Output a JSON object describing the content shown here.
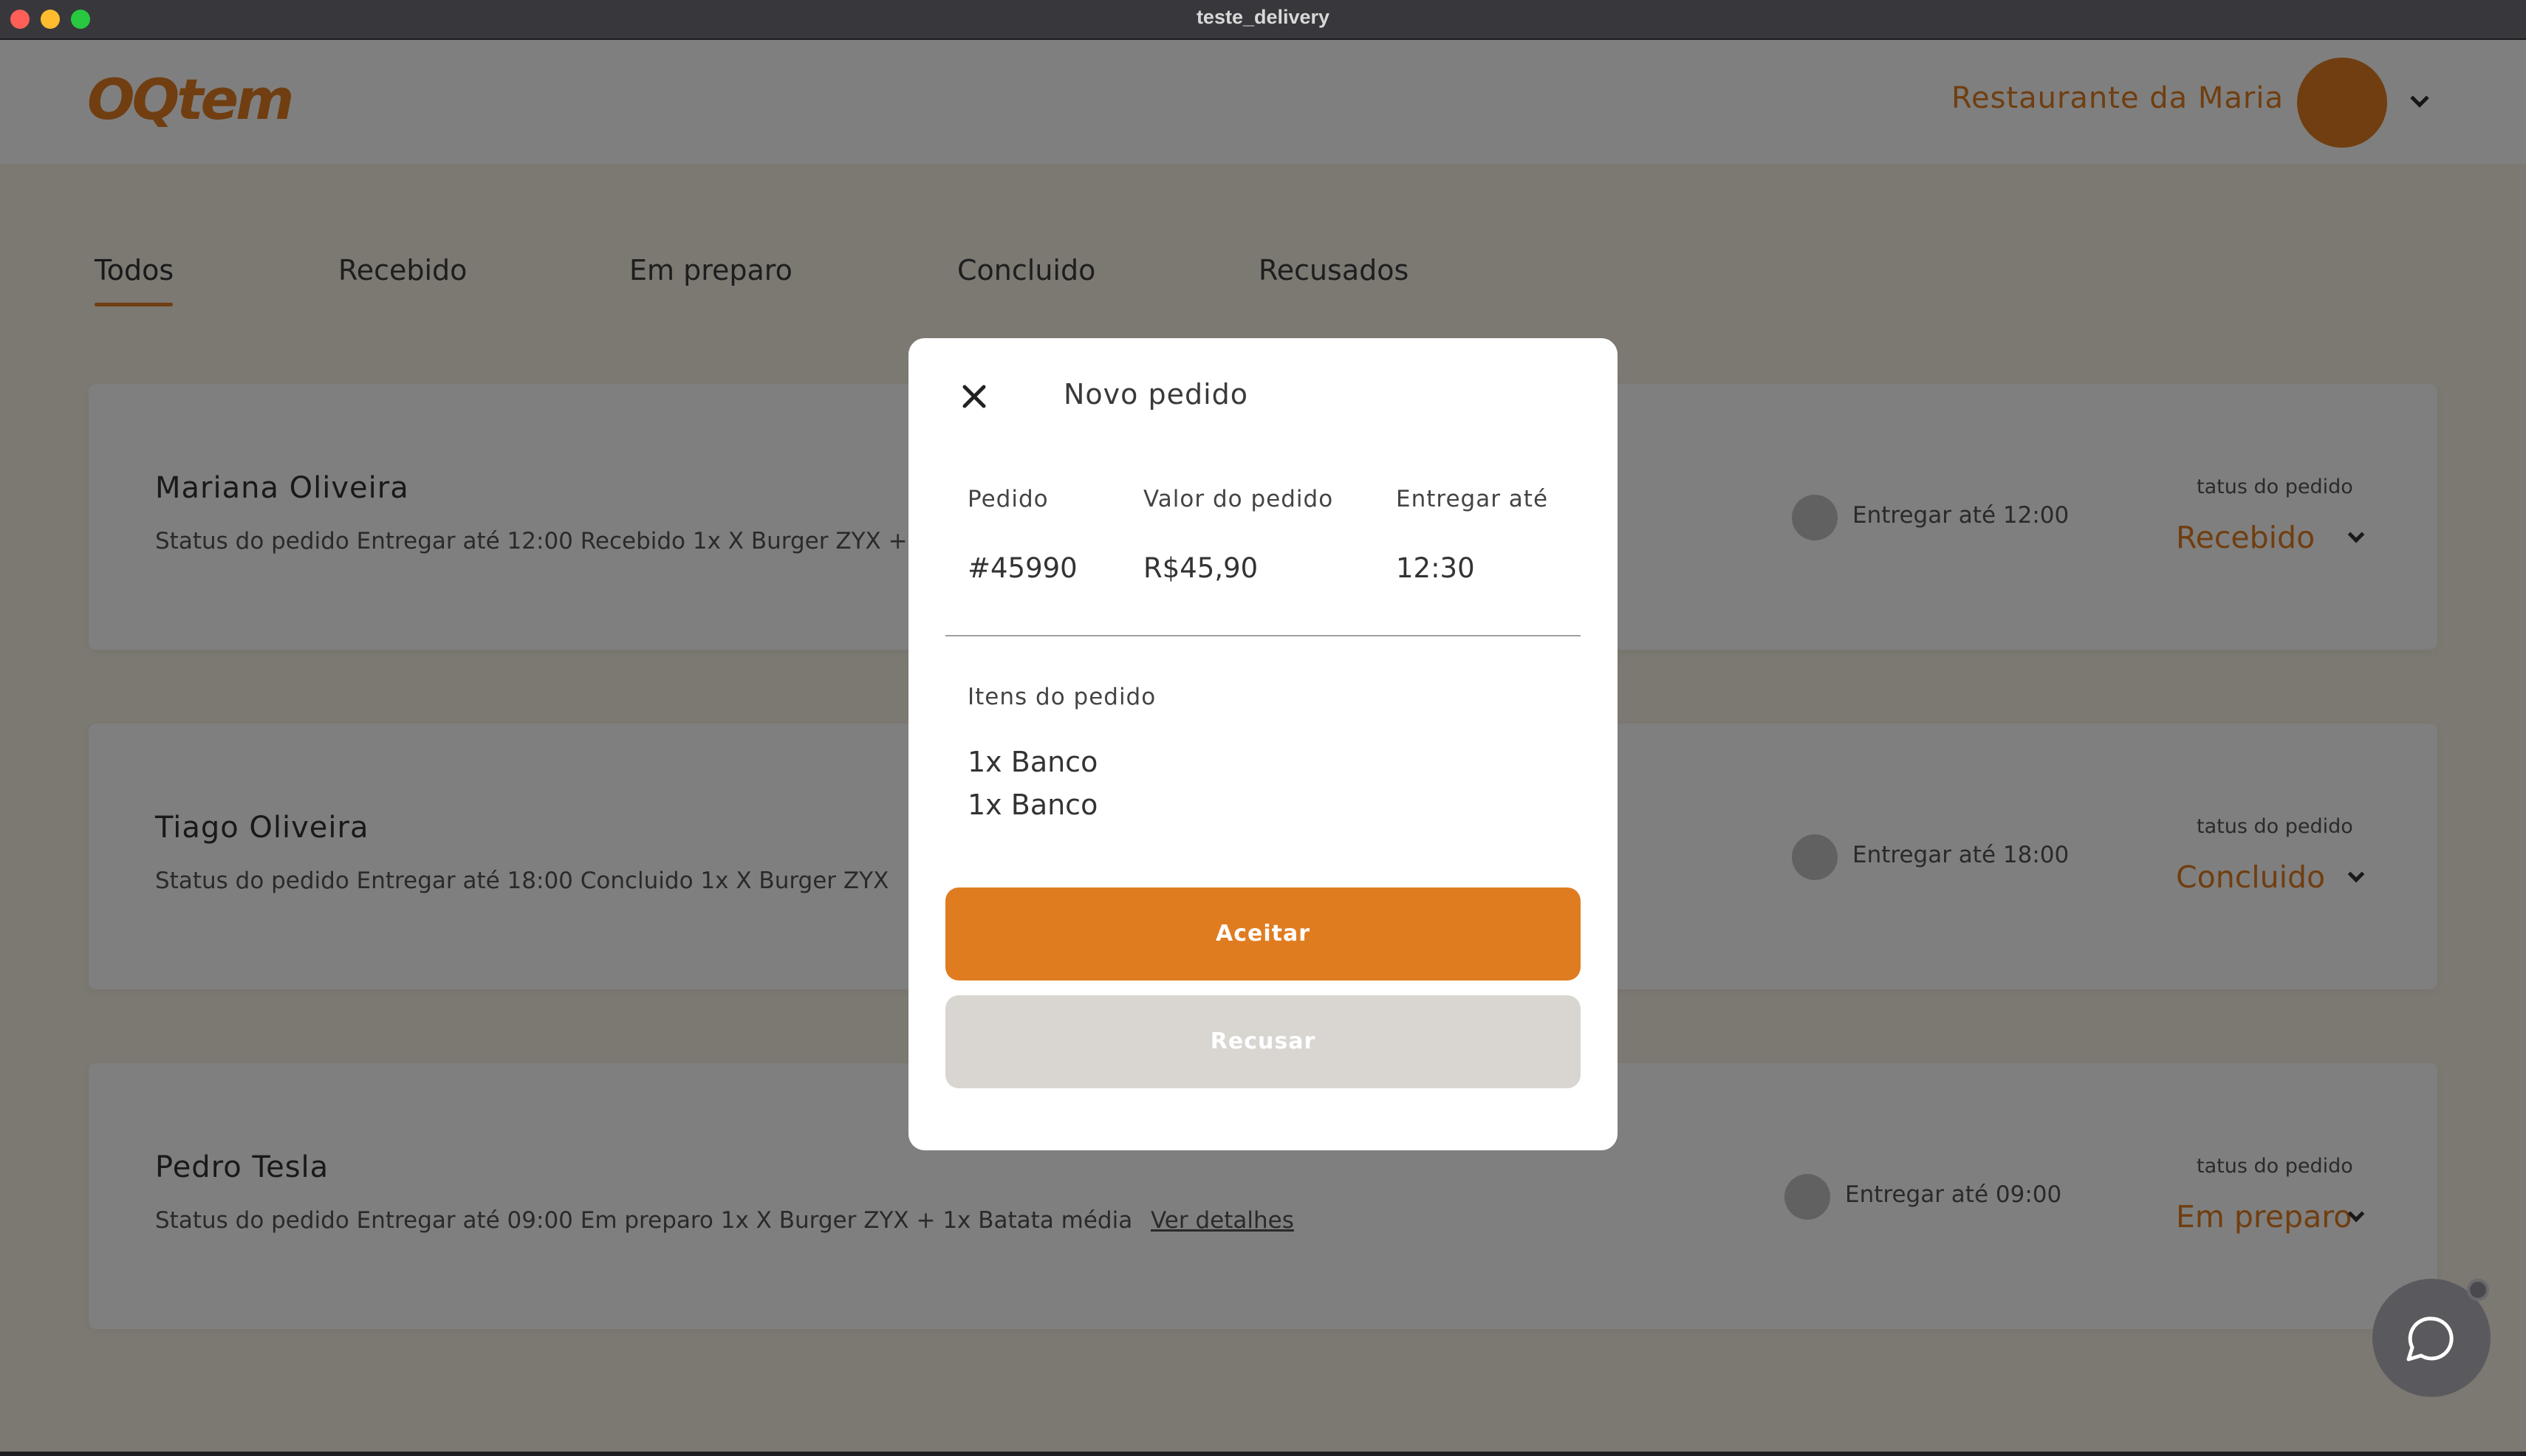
{
  "window": {
    "title": "teste_delivery"
  },
  "header": {
    "logo_text": "OQtem",
    "restaurant_name": "Restaurante da Maria"
  },
  "tabs": [
    {
      "label": "Todos",
      "active": true
    },
    {
      "label": "Recebido"
    },
    {
      "label": "Em preparo"
    },
    {
      "label": "Concluido"
    },
    {
      "label": "Recusados"
    }
  ],
  "orders": [
    {
      "customer": "Mariana Oliveira",
      "summary": "Status do pedido Entregar até 12:00 Recebido 1x X Burger ZYX + 1x",
      "deliver_label": "Entregar até 12:00",
      "status_caption": "tatus do pedido",
      "status": "Recebido"
    },
    {
      "customer": "Tiago Oliveira",
      "summary": "Status do pedido Entregar até 18:00 Concluido 1x X Burger ZYX",
      "deliver_label": "Entregar até 18:00",
      "status_caption": "tatus do pedido",
      "status": "Concluido"
    },
    {
      "customer": "Pedro Tesla",
      "summary": "Status do pedido Entregar até 09:00 Em preparo 1x X Burger ZYX + 1x Batata média",
      "details_link": "Ver detalhes",
      "deliver_label": "Entregar até 09:00",
      "status_caption": "tatus do pedido",
      "status": "Em preparo"
    }
  ],
  "modal": {
    "title": "Novo pedido",
    "columns": [
      {
        "label": "Pedido",
        "value": "#45990"
      },
      {
        "label": "Valor do pedido",
        "value": "R$45,90"
      },
      {
        "label": "Entregar até",
        "value": "12:30"
      }
    ],
    "items_label": "Itens do pedido",
    "items": [
      "1x Banco",
      "1x Banco"
    ],
    "accept_label": "Aceitar",
    "refuse_label": "Recusar"
  },
  "colors": {
    "accent": "#e07c20",
    "background": "#f8f1e4",
    "refuse_button": "#d9d6d2"
  },
  "icons": {
    "close": "close-icon",
    "chevron": "chevron-down-icon",
    "chat": "chat-bubble-icon"
  }
}
